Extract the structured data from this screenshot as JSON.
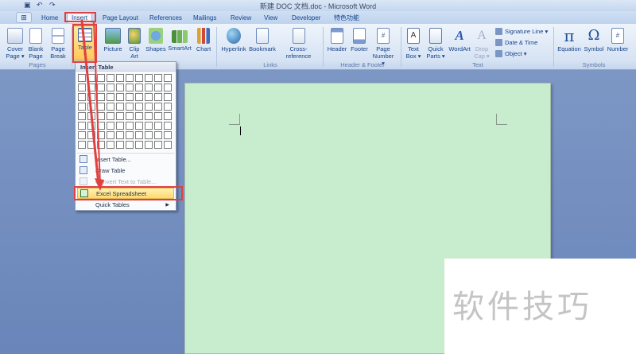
{
  "window": {
    "title": "新建 DOC 文档.doc - Microsoft Word"
  },
  "tabs": [
    {
      "label": "Home"
    },
    {
      "label": "Insert"
    },
    {
      "label": "Page Layout"
    },
    {
      "label": "References"
    },
    {
      "label": "Mailings"
    },
    {
      "label": "Review"
    },
    {
      "label": "View"
    },
    {
      "label": "Developer"
    },
    {
      "label": "特色功能"
    }
  ],
  "ribbon": {
    "pages": {
      "label": "Pages",
      "cover_line1": "Cover",
      "cover_line2": "Page ▾",
      "blank_line1": "Blank",
      "blank_line2": "Page",
      "break_line1": "Page",
      "break_line2": "Break"
    },
    "tables": {
      "table_label": "Table",
      "table_arrow": "▾"
    },
    "illustrations": {
      "picture": "Picture",
      "clip_line1": "Clip",
      "clip_line2": "Art",
      "shapes": "Shapes",
      "smartart": "SmartArt",
      "chart": "Chart"
    },
    "links": {
      "label": "Links",
      "hyperlink": "Hyperlink",
      "bookmark": "Bookmark",
      "crossref": "Cross-reference"
    },
    "header_footer": {
      "label": "Header & Footer",
      "header": "Header",
      "footer": "Footer",
      "pagenum_line1": "Page",
      "pagenum_line2": "Number ▾"
    },
    "text": {
      "label": "Text",
      "textbox_line1": "Text",
      "textbox_line2": "Box ▾",
      "quickparts_line1": "Quick",
      "quickparts_line2": "Parts ▾",
      "wordart": "WordArt",
      "dropcap_line1": "Drop",
      "dropcap_line2": "Cap ▾",
      "signature": "Signature Line ▾",
      "datetime": "Date & Time",
      "object": "Object ▾"
    },
    "symbols": {
      "label": "Symbols",
      "equation": "Equation",
      "symbol": "Symbol",
      "number": "Number",
      "equation_glyph": "π",
      "symbol_glyph": "Ω",
      "number_glyph": "#"
    }
  },
  "insert_table_menu": {
    "header": "Insert Table",
    "items": [
      {
        "label": "Insert Table...",
        "disabled": false
      },
      {
        "label": "Draw Table",
        "disabled": false
      },
      {
        "label": "Convert Text to Table...",
        "disabled": true
      },
      {
        "label": "Excel Spreadsheet",
        "highlighted": true
      },
      {
        "label": "Quick Tables",
        "has_submenu": true
      }
    ],
    "grid": {
      "columns": 10,
      "rows": 8
    }
  },
  "watermark": {
    "text": "软件技巧"
  },
  "colors": {
    "annotation": "#e04040",
    "page": "#c8ecce",
    "highlight": "#ffd973",
    "workspace": "#7d97c5"
  }
}
